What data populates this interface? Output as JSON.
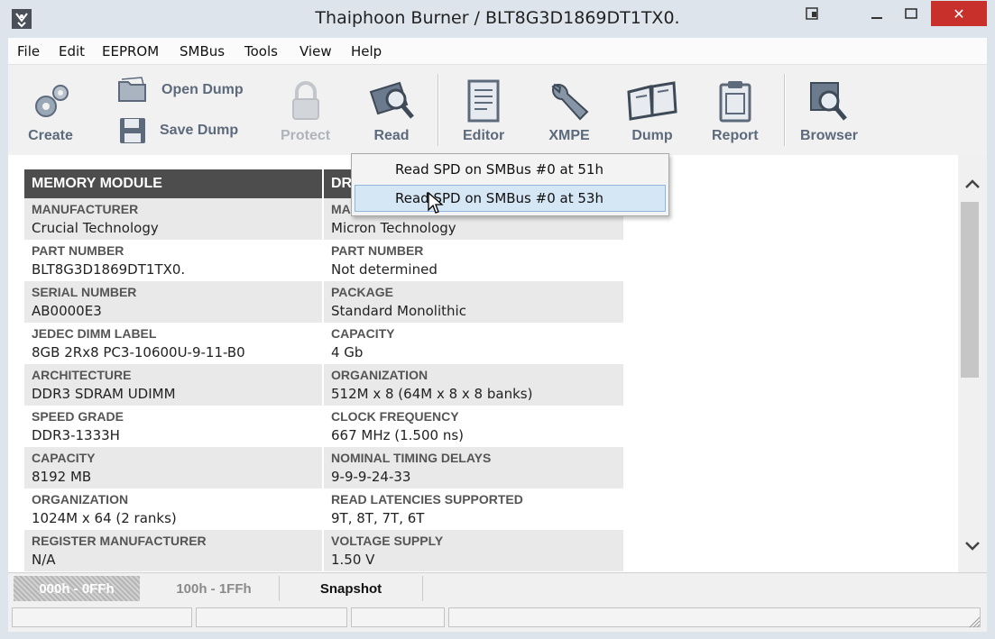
{
  "window": {
    "title": "Thaiphoon Burner / BLT8G3D1869DT1TX0.",
    "close_glyph": "✕"
  },
  "menu": [
    "File",
    "Edit",
    "EEPROM",
    "SMBus",
    "Tools",
    "View",
    "Help"
  ],
  "toolbar": {
    "create": "Create",
    "open_dump": "Open Dump",
    "save_dump": "Save Dump",
    "protect": "Protect",
    "read": "Read",
    "editor": "Editor",
    "xmpe": "XMPE",
    "dump": "Dump",
    "report": "Report",
    "browser": "Browser"
  },
  "dropdown": {
    "items": [
      "Read SPD on SMBus #0 at 51h",
      "Read SPD on SMBus #0 at 53h"
    ]
  },
  "module": {
    "header": "MEMORY MODULE",
    "rows": [
      {
        "label": "MANUFACTURER",
        "value": "Crucial Technology"
      },
      {
        "label": "PART NUMBER",
        "value": "BLT8G3D1869DT1TX0."
      },
      {
        "label": "SERIAL NUMBER",
        "value": "AB0000E3"
      },
      {
        "label": "JEDEC DIMM LABEL",
        "value": "8GB 2Rx8 PC3-10600U-9-11-B0"
      },
      {
        "label": "ARCHITECTURE",
        "value": "DDR3 SDRAM UDIMM"
      },
      {
        "label": "SPEED GRADE",
        "value": "DDR3-1333H"
      },
      {
        "label": "CAPACITY",
        "value": "8192 MB"
      },
      {
        "label": "ORGANIZATION",
        "value": "1024M x 64 (2 ranks)"
      },
      {
        "label": "REGISTER MANUFACTURER",
        "value": "N/A"
      }
    ]
  },
  "dram": {
    "header": "DR",
    "rows": [
      {
        "label": "MA",
        "value": "Micron Technology"
      },
      {
        "label": "PART NUMBER",
        "value": "Not determined"
      },
      {
        "label": "PACKAGE",
        "value": "Standard Monolithic"
      },
      {
        "label": "CAPACITY",
        "value": "4 Gb"
      },
      {
        "label": "ORGANIZATION",
        "value": "512M x 8 (64M x 8 x 8 banks)"
      },
      {
        "label": "CLOCK FREQUENCY",
        "value": "667 MHz (1.500 ns)"
      },
      {
        "label": "NOMINAL TIMING DELAYS",
        "value": "9-9-9-24-33"
      },
      {
        "label": "READ LATENCIES SUPPORTED",
        "value": "9T, 8T, 7T, 6T"
      },
      {
        "label": "VOLTAGE SUPPLY",
        "value": "1.50 V"
      }
    ]
  },
  "tabs": [
    "000h - 0FFh",
    "100h - 1FFh",
    "Snapshot"
  ],
  "colors": {
    "header_bg": "#4d4d4d",
    "accent_label": "#5d6a7c",
    "close_red": "#c7302b",
    "selected_item": "#d5e6f5"
  }
}
